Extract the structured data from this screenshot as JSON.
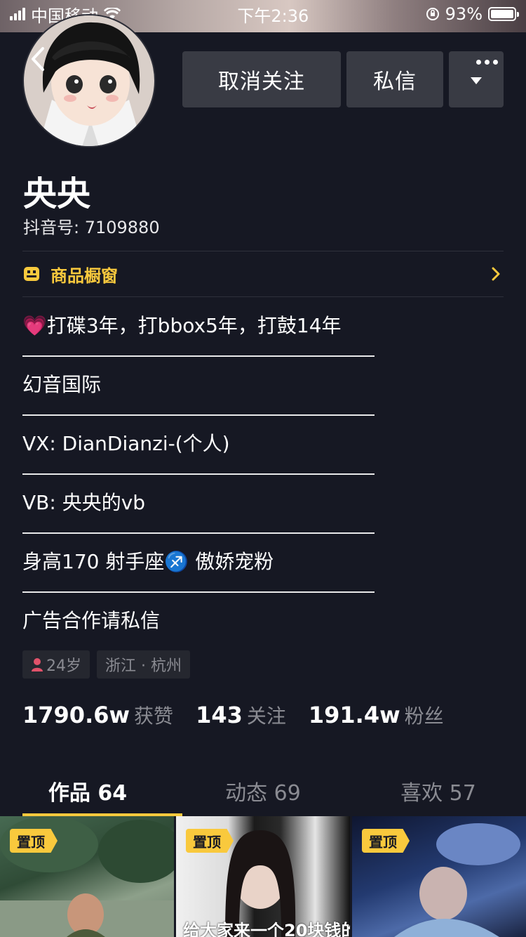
{
  "status_bar": {
    "carrier": "中国移动",
    "time": "下午2:36",
    "battery": "93%"
  },
  "actions": {
    "unfollow_label": "取消关注",
    "message_label": "私信"
  },
  "profile": {
    "nickname": "央央",
    "douyin_id": "抖音号: 7109880"
  },
  "shop": {
    "label": "商品橱窗"
  },
  "bio": {
    "lines": [
      "💗打碟3年，打bbox5年，打鼓14年",
      "幻音国际",
      "VX: DianDianzi-(个人)",
      "VB: 央央的vb",
      "身高170 射手座♐️ 傲娇宠粉",
      "广告合作请私信"
    ]
  },
  "tags": {
    "age": "24岁",
    "location": "浙江 · 杭州"
  },
  "stats": {
    "likes_count": "1790.6w",
    "likes_label": "获赞",
    "following_count": "143",
    "following_label": "关注",
    "followers_count": "191.4w",
    "followers_label": "粉丝"
  },
  "tabs": [
    {
      "label": "作品 64",
      "active": true
    },
    {
      "label": "动态 69",
      "active": false
    },
    {
      "label": "喜欢 57",
      "active": false
    }
  ],
  "videos": [
    {
      "badge": "置顶",
      "caption": ""
    },
    {
      "badge": "置顶",
      "caption": "给大家来一个20块钱的"
    },
    {
      "badge": "置顶",
      "caption": ""
    }
  ],
  "colors": {
    "background": "#161823",
    "accent_yellow": "#f9c93d",
    "button_bg": "#393b44",
    "muted_text": "#8a8b92",
    "gender_icon": "#e1526a"
  },
  "icons": {
    "back": "chevron-left-icon",
    "more": "more-dots-icon",
    "dropdown": "triangle-down-icon",
    "shop": "shop-window-icon",
    "shop_arrow": "chevron-right-icon",
    "gender": "female-user-icon"
  }
}
